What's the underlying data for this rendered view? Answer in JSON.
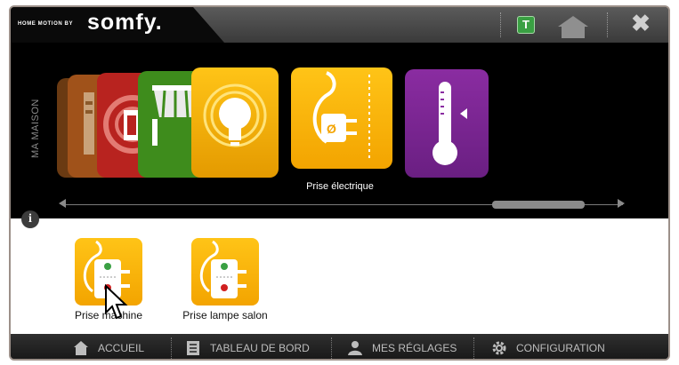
{
  "header": {
    "brand_small": "HOME MOTION BY",
    "brand_big": "somfy.",
    "badge_letter": "T",
    "close_symbol": "✖",
    "home_icon": "home-icon"
  },
  "carousel": {
    "section_label": "MA MAISON",
    "selected_label": "Prise électrique",
    "cards": [
      {
        "name": "shutter",
        "color": "#a0521a"
      },
      {
        "name": "door",
        "color": "#b8231f"
      },
      {
        "name": "awning",
        "color": "#3e8c1c"
      },
      {
        "name": "lighting",
        "color": "#f0a800"
      },
      {
        "name": "plug",
        "color": "#f6b800"
      },
      {
        "name": "thermostat",
        "color": "#7a2a8f"
      }
    ]
  },
  "devices": [
    {
      "label": "Prise machine"
    },
    {
      "label": "Prise lampe salon"
    }
  ],
  "info_symbol": "i",
  "nav": {
    "items": [
      {
        "label": "ACCUEIL",
        "icon": "home-icon"
      },
      {
        "label": "TABLEAU DE BORD",
        "icon": "dashboard-icon"
      },
      {
        "label": "MES RÉGLAGES",
        "icon": "user-icon"
      },
      {
        "label": "CONFIGURATION",
        "icon": "gear-icon"
      }
    ]
  }
}
